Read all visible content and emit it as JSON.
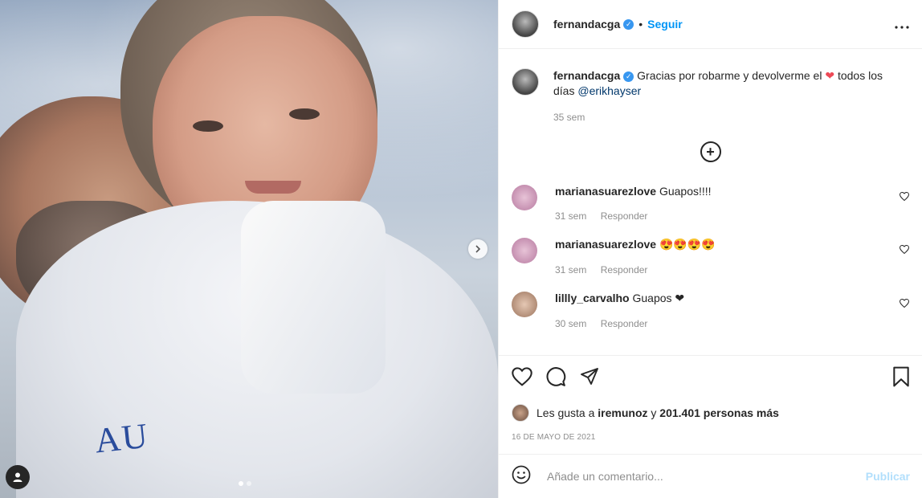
{
  "post": {
    "username": "fernandacga",
    "separator": "•",
    "follow_label": "Seguir",
    "more_icon": "more-options-icon",
    "photo_logo_text": "AU",
    "next_icon": "chevron-right-icon",
    "carousel_count": 2,
    "carousel_active": 1
  },
  "caption": {
    "username": "fernandacga",
    "text_before": "Gracias por robarme y devolverme el",
    "heart": "❤",
    "text_after": " todos los días ",
    "mention": "@erikhayser",
    "time": "35 sem"
  },
  "comments": [
    {
      "username": "marianasuarezlove",
      "text": "Guapos!!!!",
      "time": "31 sem",
      "reply": "Responder",
      "avatar_color": "#d8a6c8"
    },
    {
      "username": "marianasuarezlove",
      "text": "😍😍😍😍",
      "time": "31 sem",
      "reply": "Responder",
      "avatar_color": "#d8a6c8"
    },
    {
      "username": "lillly_carvalho",
      "text": "Guapos ❤",
      "time": "30 sem",
      "reply": "Responder",
      "avatar_color": "#c9a48a"
    }
  ],
  "actions": {
    "like_icon": "heart-icon",
    "comment_icon": "comment-icon",
    "share_icon": "share-icon",
    "save_icon": "bookmark-icon"
  },
  "likes": {
    "prefix": "Les gusta a",
    "user": "iremunoz",
    "middle": "y",
    "count": "201.401 personas más"
  },
  "date": "16 DE MAYO DE 2021",
  "add_comment": {
    "placeholder": "Añade un comentario...",
    "publish_label": "Publicar"
  },
  "colors": {
    "accent": "#0095f6",
    "heart": "#ed4956",
    "muted": "#8e8e8e"
  }
}
